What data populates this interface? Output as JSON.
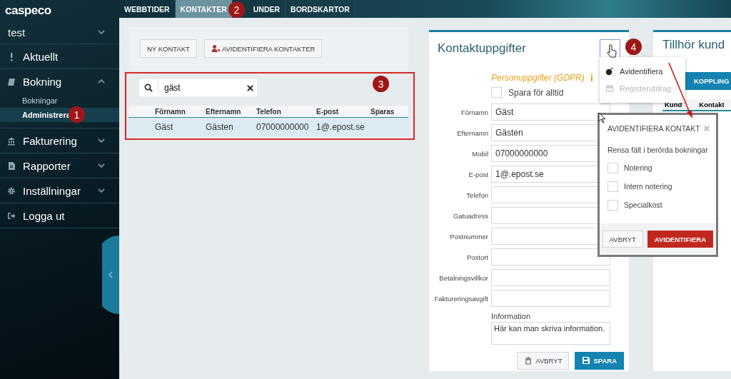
{
  "sidebar": {
    "logo": "caspeco",
    "account": "test",
    "items": [
      {
        "kind": "link",
        "label": "Aktuellt"
      },
      {
        "kind": "group",
        "label": "Bokning",
        "expanded": true,
        "children": [
          {
            "label": "Bokningar",
            "selected": false
          },
          {
            "label": "Administrera",
            "selected": true
          }
        ]
      },
      {
        "kind": "group",
        "label": "Fakturering",
        "expanded": false
      },
      {
        "kind": "group",
        "label": "Rapporter",
        "expanded": false
      },
      {
        "kind": "group",
        "label": "Inställningar",
        "expanded": false
      },
      {
        "kind": "link",
        "label": "Logga ut"
      }
    ]
  },
  "tabs": [
    {
      "label": "WEBBTIDER",
      "selected": false
    },
    {
      "label": "KONTAKTER",
      "selected": true
    },
    {
      "label": "UNDER",
      "selected": false
    },
    {
      "label": "BORDSKARTOR",
      "selected": false
    }
  ],
  "toolbar": {
    "buttons": [
      {
        "label": "NY KONTAKT"
      },
      {
        "label": "AVIDENTIFIERA KONTAKTER"
      }
    ]
  },
  "search": {
    "value": "gäst"
  },
  "table": {
    "columns": [
      "Förnamn",
      "Efternamn",
      "Telefon",
      "E-post",
      "Sparas"
    ],
    "rows": [
      {
        "selected": true,
        "cells": [
          "Gäst",
          "Gästen",
          "07000000000",
          "1@.epost.se"
        ]
      }
    ]
  },
  "contact_form": {
    "title": "Kontaktuppgifter",
    "gdpr_label": "Personuppgifter (GDPR)",
    "keep_forever": {
      "label": "Spara för alltid",
      "checked": false
    },
    "fields": [
      {
        "label": "Förnamn",
        "value": "Gäst"
      },
      {
        "label": "Efternamn",
        "value": "Gästen"
      },
      {
        "label": "Mobil",
        "value": "07000000000"
      },
      {
        "label": "E-post",
        "value": "1@.epost.se"
      },
      {
        "label": "Telefon"
      },
      {
        "label": "Gatuadress"
      },
      {
        "label": "Postnummer"
      },
      {
        "label": "Postort"
      },
      {
        "label": "Betalningsvillkor"
      },
      {
        "label": "Faktureringsavgift"
      }
    ],
    "information": {
      "label": "Information",
      "value": "Här kan man skriva information."
    },
    "buttons": [
      {
        "label": "AVBRYT",
        "kind": "secondary"
      },
      {
        "label": "SPARA",
        "kind": "primary"
      }
    ]
  },
  "actions_menu": {
    "items": [
      {
        "label": "Avidentifiera",
        "disabled": false
      },
      {
        "label": "Registerutdrag",
        "disabled": true
      }
    ]
  },
  "customer_card": {
    "title": "Tillhör kund",
    "button": "KOPPLING",
    "columns": [
      "Kund",
      "Kontakt"
    ]
  },
  "dialog": {
    "title": "AVIDENTIFIERA KONTAKT",
    "subtitle": "Rensa fält i berörda bokningar",
    "options": [
      {
        "label": "Notering",
        "checked": false
      },
      {
        "label": "Intern notering",
        "checked": false
      },
      {
        "label": "Specialkost",
        "checked": false
      }
    ],
    "buttons": [
      {
        "label": "AVBRYT",
        "kind": "secondary"
      },
      {
        "label": "AVIDENTIFIERA",
        "kind": "danger"
      }
    ]
  },
  "annotations": {
    "badges": [
      "1",
      "2",
      "3",
      "4"
    ]
  }
}
